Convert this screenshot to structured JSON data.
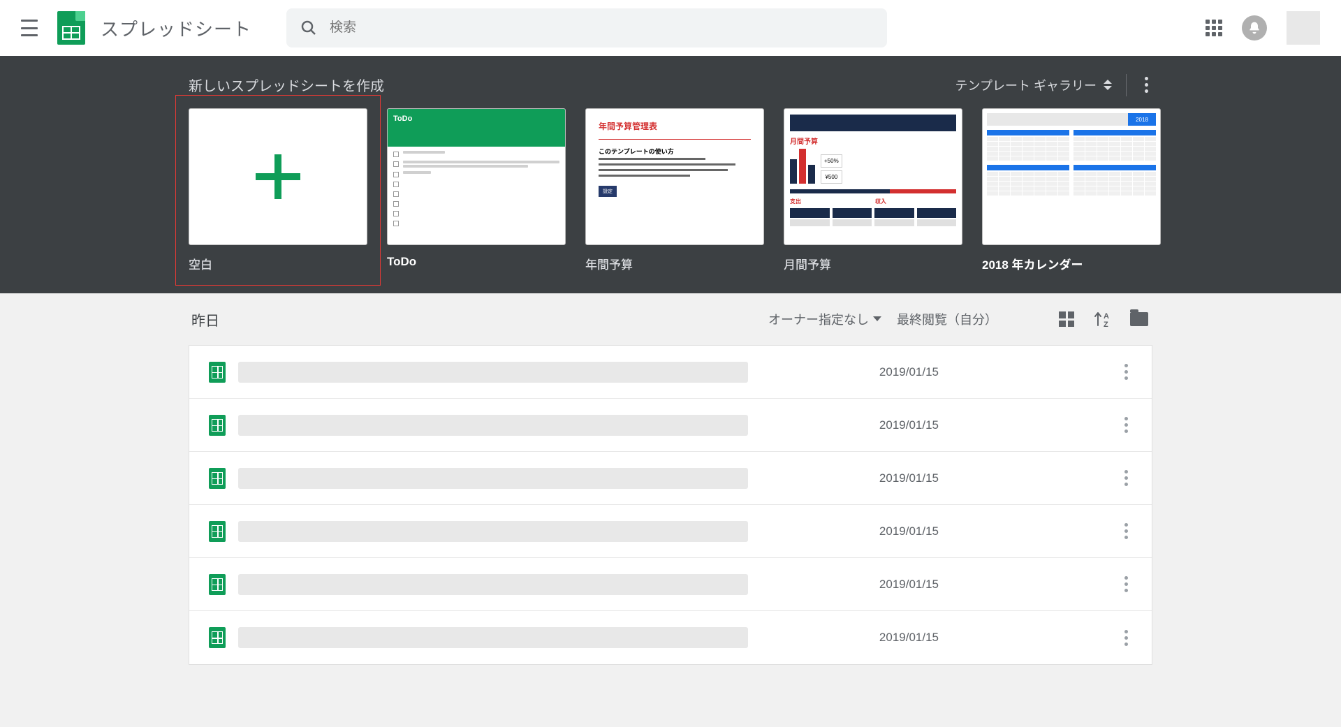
{
  "header": {
    "app_title": "スプレッドシート",
    "search_placeholder": "検索"
  },
  "templates": {
    "section_title": "新しいスプレッドシートを作成",
    "gallery_label": "テンプレート ギャラリー",
    "items": [
      {
        "label": "空白",
        "type": "blank",
        "highlighted": true
      },
      {
        "label": "ToDo",
        "type": "todo",
        "thumb_title": "ToDo"
      },
      {
        "label": "年間予算",
        "type": "annual_budget",
        "thumb_title": "年間予算管理表",
        "thumb_sub": "このテンプレートの使い方"
      },
      {
        "label": "月間予算",
        "type": "monthly_budget",
        "thumb_title": "月間予算",
        "box1": "+50%",
        "box2": "¥500"
      },
      {
        "label": "2018 年カレンダー",
        "type": "calendar",
        "year": "2018"
      }
    ]
  },
  "docs": {
    "heading": "昨日",
    "owner_filter": "オーナー指定なし",
    "sort_label": "最終閲覧（自分）",
    "rows": [
      {
        "date": "2019/01/15"
      },
      {
        "date": "2019/01/15"
      },
      {
        "date": "2019/01/15"
      },
      {
        "date": "2019/01/15"
      },
      {
        "date": "2019/01/15"
      },
      {
        "date": "2019/01/15"
      }
    ]
  }
}
